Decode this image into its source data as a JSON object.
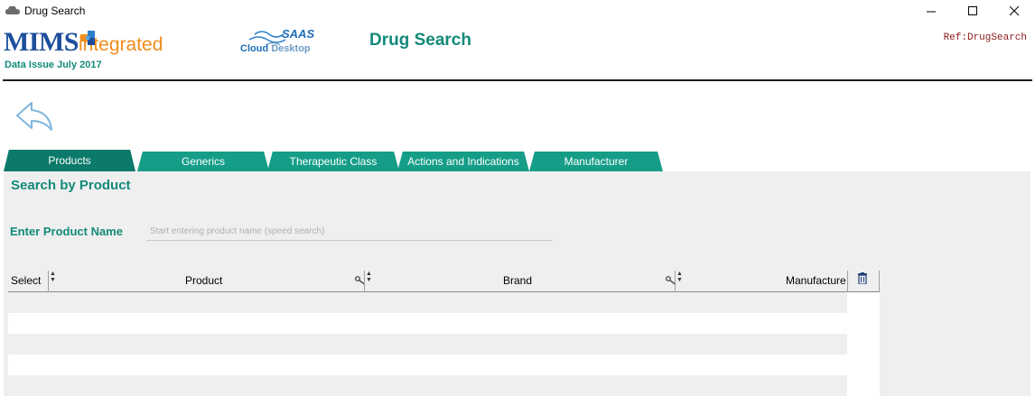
{
  "window": {
    "title": "Drug Search",
    "minimize": "—",
    "maximize": "☐",
    "close": "✕"
  },
  "header": {
    "logo_mims": "MIMS",
    "logo_integrated": "integrated",
    "data_issue": "Data Issue  July 2017",
    "saas_top": "SAAS",
    "saas_cloud": "Cloud",
    "saas_desktop": "Desktop",
    "page_title": "Drug Search",
    "ref": "Ref:DrugSearch"
  },
  "tabs": [
    {
      "label": "Products",
      "active": true
    },
    {
      "label": "Generics",
      "active": false
    },
    {
      "label": "Therapeutic Class",
      "active": false
    },
    {
      "label": "Actions and Indications",
      "active": false
    },
    {
      "label": "Manufacturer",
      "active": false
    }
  ],
  "search": {
    "section_title": "Search by Product",
    "field_label": "Enter Product Name",
    "placeholder": "Start entering product name (speed search)",
    "value": ""
  },
  "grid": {
    "columns": [
      "Select",
      "Product",
      "Brand",
      "Manufacture"
    ],
    "rows": [
      "",
      "",
      "",
      "",
      ""
    ]
  },
  "colors": {
    "accent": "#138a7a",
    "tab": "#159d88",
    "tab_active": "#0b7a6a",
    "brand_blue": "#1d4e9e",
    "brand_orange": "#f28c1a"
  }
}
